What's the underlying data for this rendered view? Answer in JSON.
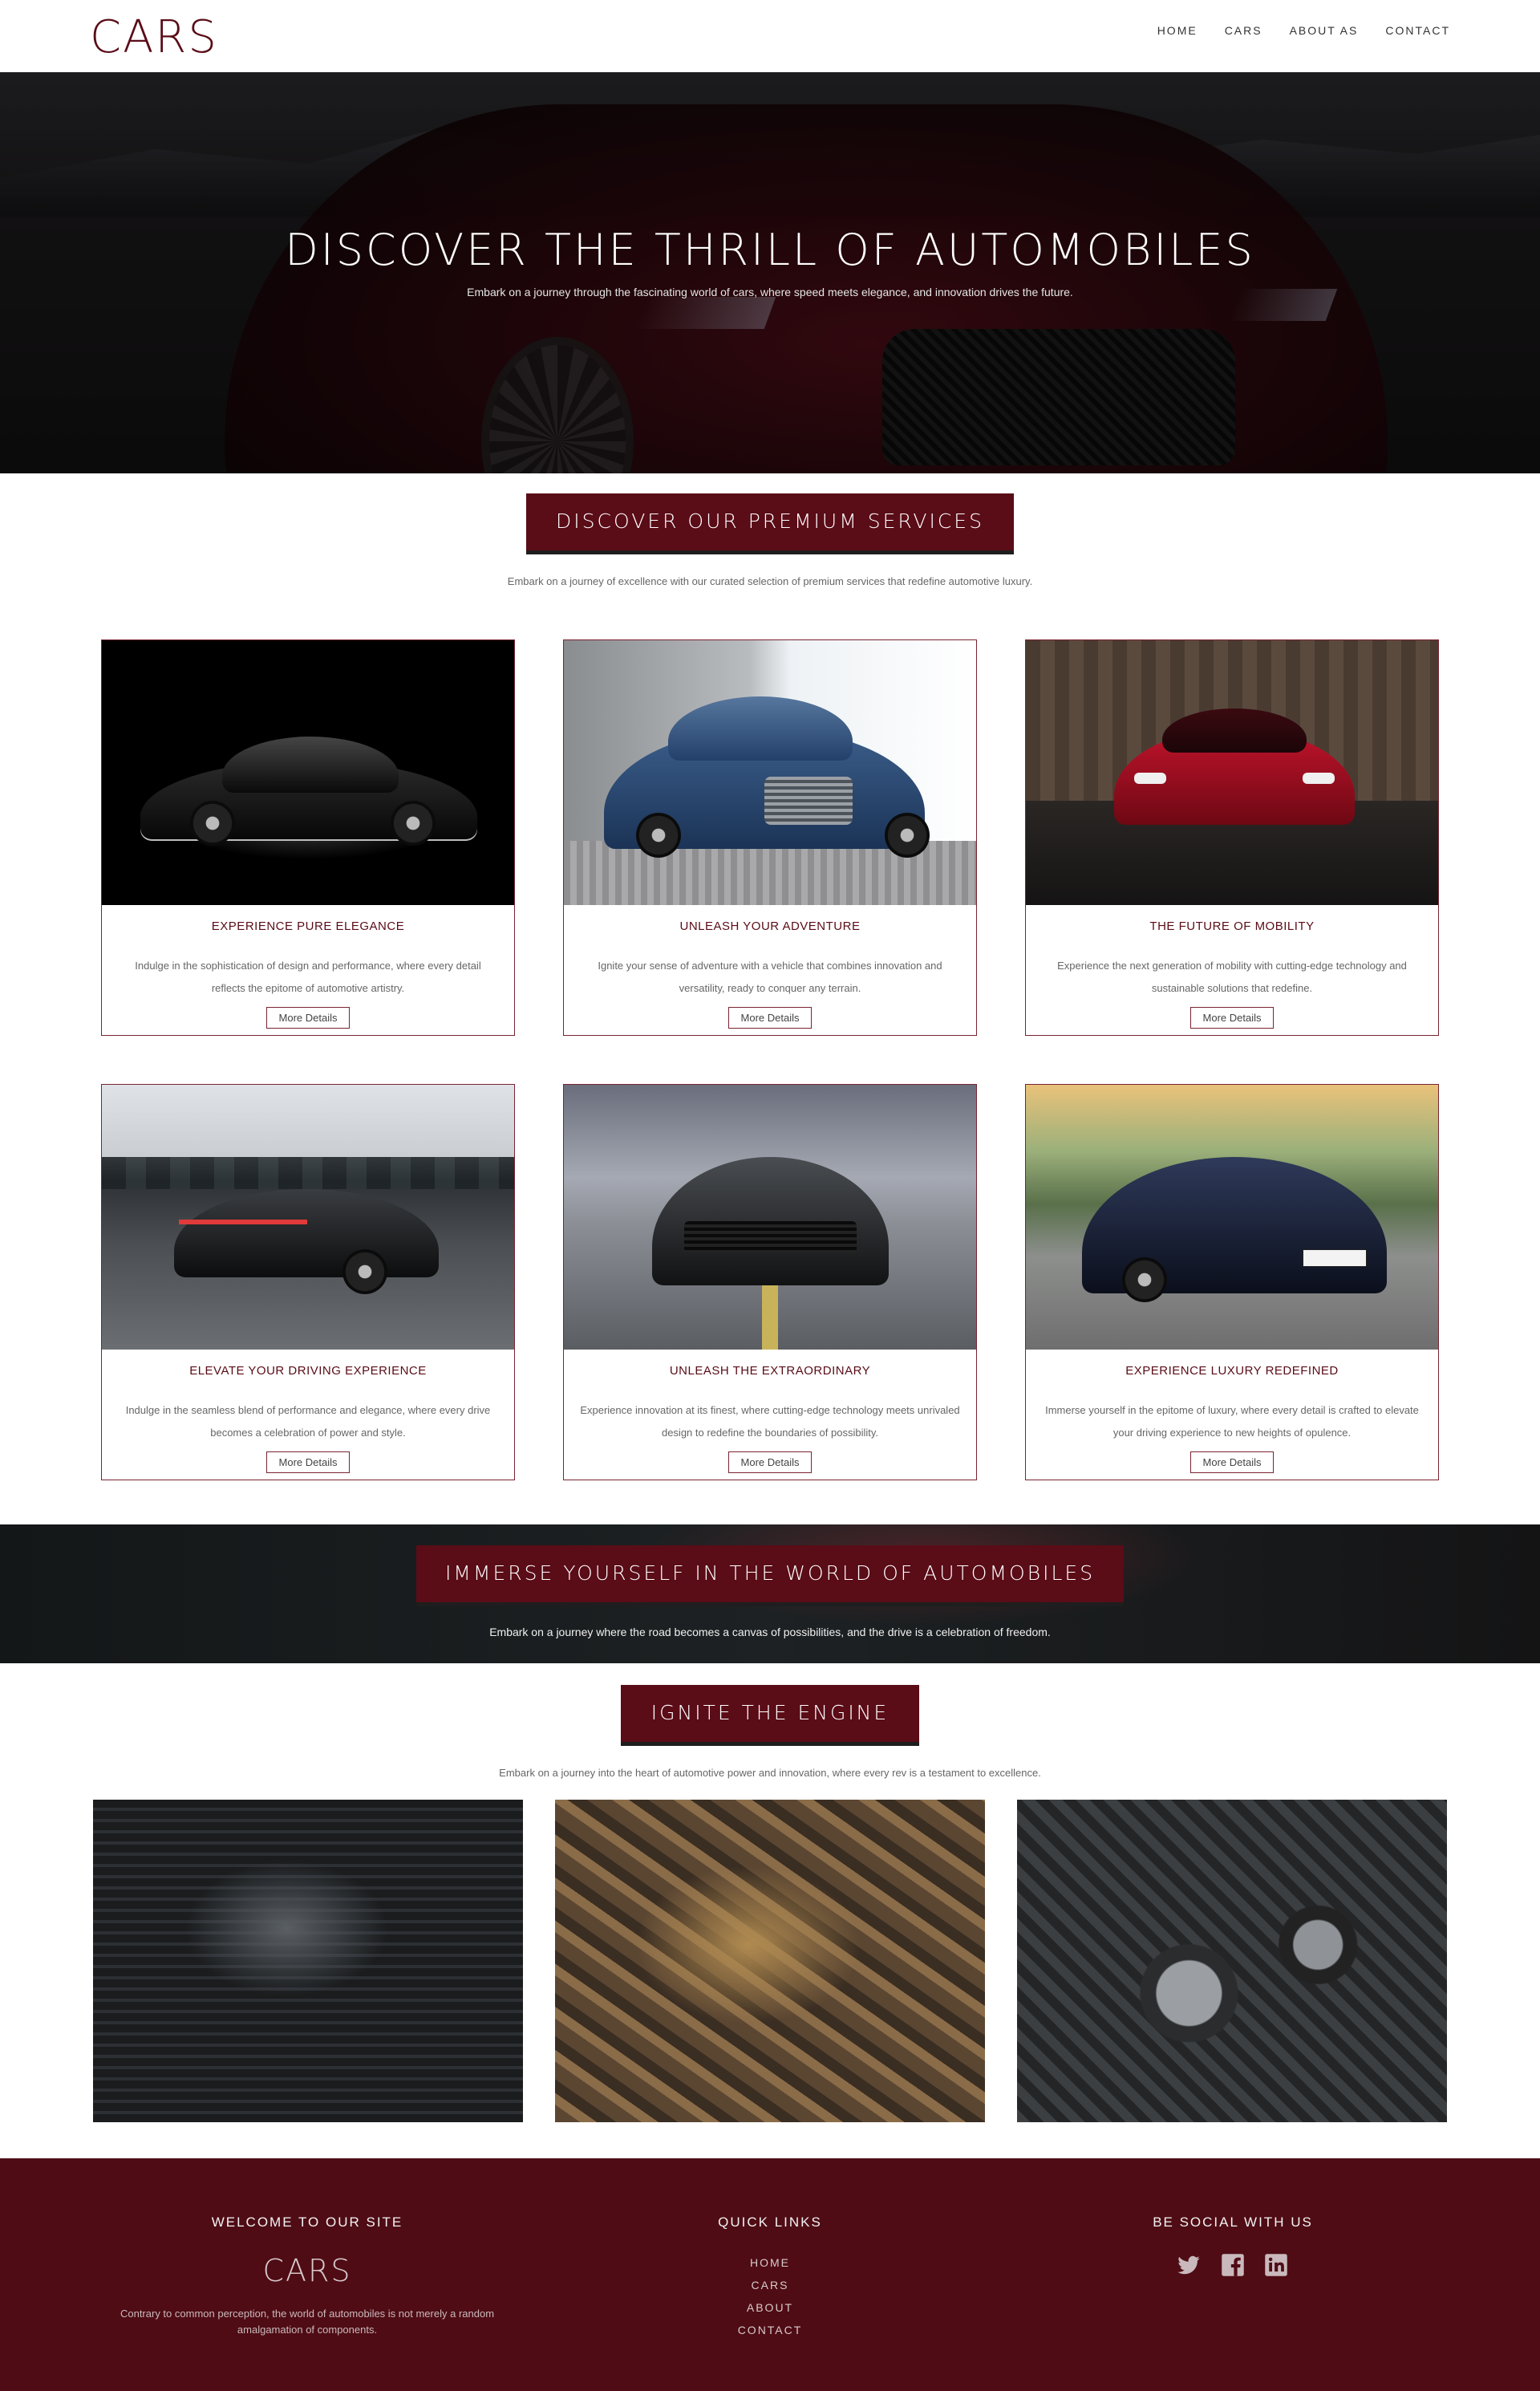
{
  "navbar": {
    "brand": "CARS",
    "links": [
      "HOME",
      "CARS",
      "ABOUT AS",
      "CONTACT"
    ]
  },
  "hero": {
    "title": "DISCOVER THE THRILL OF AUTOMOBILES",
    "subtitle": "Embark on a journey through the fascinating world of cars, where speed meets elegance, and innovation drives the future."
  },
  "services": {
    "title": "DISCOVER OUR PREMIUM SERVICES",
    "description": "Embark on a journey of excellence with our curated selection of premium services that redefine automotive luxury.",
    "button_label": "More Details",
    "cards": [
      {
        "title": "EXPERIENCE PURE ELEGANCE",
        "desc": "Indulge in the sophistication of design and performance, where every detail reflects the epitome of automotive artistry."
      },
      {
        "title": "UNLEASH YOUR ADVENTURE",
        "desc": "Ignite your sense of adventure with a vehicle that combines innovation and versatility, ready to conquer any terrain."
      },
      {
        "title": "THE FUTURE OF MOBILITY",
        "desc": "Experience the next generation of mobility with cutting-edge technology and sustainable solutions that redefine."
      },
      {
        "title": "ELEVATE YOUR DRIVING EXPERIENCE",
        "desc": "Indulge in the seamless blend of performance and elegance, where every drive becomes a celebration of power and style."
      },
      {
        "title": "UNLEASH THE EXTRAORDINARY",
        "desc": "Experience innovation at its finest, where cutting-edge technology meets unrivaled design to redefine the boundaries of possibility."
      },
      {
        "title": "EXPERIENCE LUXURY REDEFINED",
        "desc": "Immerse yourself in the epitome of luxury, where every detail is crafted to elevate your driving experience to new heights of opulence."
      }
    ]
  },
  "immerse": {
    "title": "IMMERSE YOURSELF IN THE WORLD OF AUTOMOBILES",
    "subtitle": "Embark on a journey where the road becomes a canvas of possibilities, and the drive is a celebration of freedom."
  },
  "engine": {
    "title": "IGNITE THE ENGINE",
    "description": "Embark on a journey into the heart of automotive power and innovation, where every rev is a testament to excellence."
  },
  "footer": {
    "welcome_heading": "WELCOME TO OUR SITE",
    "brand": "CARS",
    "text": "Contrary to common perception, the world of automobiles is not merely a random amalgamation of components.",
    "links_heading": "QUICK LINKS",
    "links": [
      "HOME",
      "CARS",
      "ABOUT",
      "CONTACT"
    ],
    "social_heading": "BE SOCIAL WITH US",
    "social_icons": [
      "twitter-icon",
      "facebook-icon",
      "linkedin-icon"
    ]
  },
  "colors": {
    "brand": "#5a0c17",
    "footer_bg": "#4f0c15",
    "card_border": "#7a2332"
  }
}
